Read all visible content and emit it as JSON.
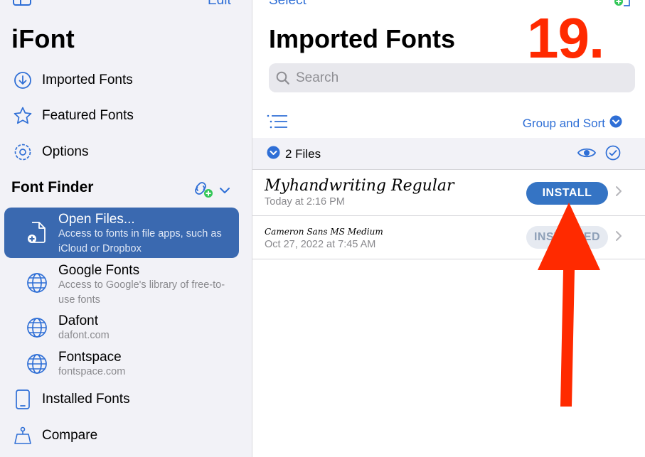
{
  "sidebar": {
    "edit_label": "Edit",
    "app_title": "iFont",
    "nav": [
      {
        "label": "Imported Fonts",
        "icon": "arrow-down-circle-icon"
      },
      {
        "label": "Featured Fonts",
        "icon": "star-icon"
      },
      {
        "label": "Options",
        "icon": "gear-icon"
      }
    ],
    "font_finder": {
      "title": "Font Finder",
      "items": [
        {
          "title": "Open Files...",
          "subtitle": "Access to fonts in file apps, such as iCloud or Dropbox",
          "icon": "document-add-icon",
          "selected": true
        },
        {
          "title": "Google Fonts",
          "subtitle": "Access to Google's library of free-to-use fonts",
          "icon": "globe-icon"
        },
        {
          "title": "Dafont",
          "subtitle": "dafont.com",
          "icon": "globe-icon"
        },
        {
          "title": "Fontspace",
          "subtitle": "fontspace.com",
          "icon": "globe-icon"
        }
      ]
    },
    "bottom_nav": [
      {
        "label": "Installed Fonts",
        "icon": "iphone-icon"
      },
      {
        "label": "Compare",
        "icon": "scale-icon"
      }
    ]
  },
  "main": {
    "select_label": "Select",
    "title": "Imported Fonts",
    "search_placeholder": "Search",
    "group_sort_label": "Group and Sort",
    "files_count": "2 Files",
    "fonts": [
      {
        "name": "Myhandwriting Regular",
        "date": "Today at 2:16 PM",
        "button": "INSTALL"
      },
      {
        "name": "Cameron Sans MS Medium",
        "date": "Oct 27, 2022 at 7:45 AM",
        "button": "INSTALLED"
      }
    ]
  },
  "annotation": {
    "step_number": "19.",
    "color": "#ff2a00"
  },
  "colors": {
    "accent": "#2f6fd6",
    "selected_bg": "#3a69b0",
    "install_btn": "#3574c4"
  }
}
